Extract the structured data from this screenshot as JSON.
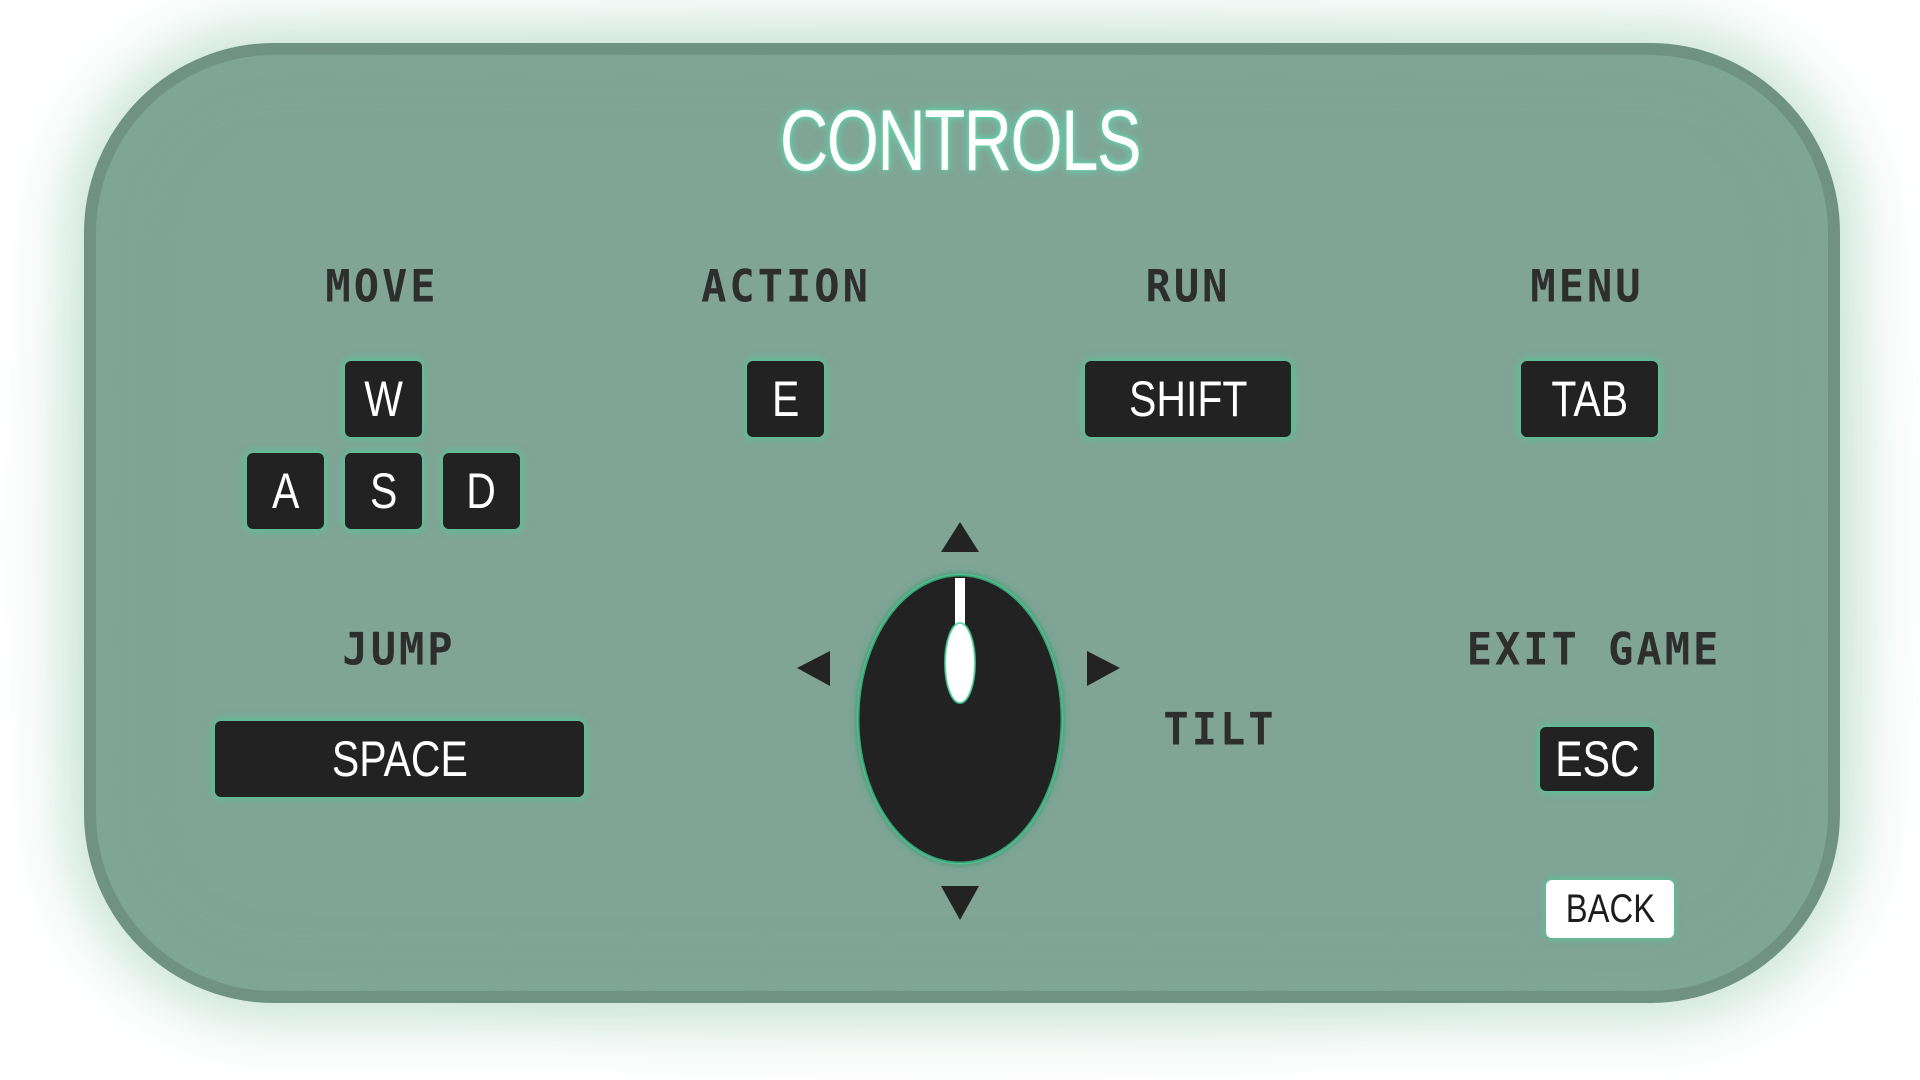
{
  "screen": {
    "title": "CONTROLS"
  },
  "controls": {
    "move": {
      "label": "MOVE",
      "keys": [
        "W",
        "A",
        "S",
        "D"
      ]
    },
    "action": {
      "label": "ACTION",
      "key": "E"
    },
    "run": {
      "label": "RUN",
      "key": "SHIFT"
    },
    "menu": {
      "label": "MENU",
      "key": "TAB"
    },
    "jump": {
      "label": "JUMP",
      "key": "SPACE"
    },
    "tilt": {
      "label": "TILT",
      "icon": "mouse-icon"
    },
    "exit": {
      "label": "EXIT GAME",
      "key": "ESC"
    }
  },
  "buttons": {
    "back": "BACK"
  },
  "colors": {
    "panel": "#80a496",
    "panel_border": "#6f9283",
    "key_bg": "#222222",
    "glow": "#46d296",
    "label_text": "#2e2e2e"
  }
}
